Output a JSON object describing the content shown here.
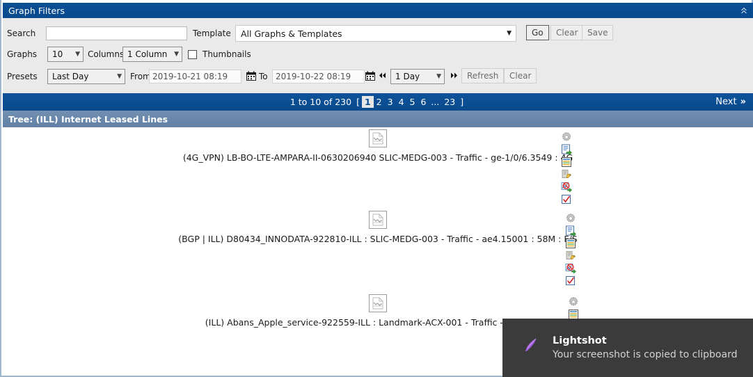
{
  "window": {
    "title": "Graph Filters",
    "collapse_icon": "chevron-double-up-icon"
  },
  "filters": {
    "search_label": "Search",
    "search_value": "",
    "search_placeholder": "",
    "template_label": "Template",
    "template_value": "All Graphs & Templates",
    "go_label": "Go",
    "clear_label": "Clear",
    "save_label": "Save",
    "graphs_label": "Graphs",
    "graphs_value": "10",
    "columns_label": "Columns",
    "columns_value": "1 Column",
    "thumbnails_label": "Thumbnails",
    "thumbnails_checked": false,
    "presets_label": "Presets",
    "presets_value": "Last Day",
    "from_label": "From",
    "from_value": "2019-10-21 08:19",
    "to_label": "To",
    "to_value": "2019-10-22 08:19",
    "calendar_icon": "calendar-icon",
    "prev_icon": "double-arrow-left-icon",
    "next_icon": "double-arrow-right-icon",
    "span_value": "1 Day",
    "refresh_label": "Refresh",
    "clear2_label": "Clear"
  },
  "pagination": {
    "summary": "1 to 10 of 230",
    "open_bracket": "[",
    "close_bracket": "]",
    "pages": [
      "1",
      "2",
      "3",
      "4",
      "5",
      "6"
    ],
    "ellipsis": "...",
    "last_page": "23",
    "current_page": "1",
    "next_label": "Next",
    "next_chevron": "»"
  },
  "tree": {
    "header": "Tree: (ILL) Internet Leased Lines"
  },
  "graphs": [
    {
      "title": "(4G_VPN) LB-BO-LTE-AMPARA-II-0630206940 SLIC-MEDG-003 - Traffic - ge-1/0/6.3549 : 4G",
      "image_state": "broken-image",
      "icons": [
        "gear-icon",
        "page-export-icon",
        "properties-list-icon",
        "edit-graph-icon",
        "graph-disable-icon",
        "checkbox-checked-icon"
      ]
    },
    {
      "title": "(BGP | ILL) D80434_INNODATA-922810-ILL : SLIC-MEDG-003 - Traffic - ae4.15001 : 58M : F/S",
      "image_state": "broken-image",
      "icons": [
        "gear-icon",
        "page-export-icon",
        "properties-list-icon",
        "edit-graph-icon",
        "graph-disable-icon",
        "checkbox-checked-icon"
      ]
    },
    {
      "title": "(ILL) Abans_Apple_service-922559-ILL : Landmark-ACX-001 - Traffic - ge-1/0/1.8",
      "image_state": "broken-image",
      "icons": [
        "gear-icon",
        "properties-list-icon"
      ]
    }
  ],
  "toast": {
    "app": "Lightshot",
    "message": "Your screenshot is copied to clipboard",
    "icon": "feather-icon",
    "accent_color": "#a45de0",
    "background": "#3b3b3b"
  },
  "colors": {
    "header_blue": "#0b4f96",
    "tree_blue": "#6b89ad",
    "panel_gray": "#eaeaea",
    "page_white": "#ffffff"
  }
}
